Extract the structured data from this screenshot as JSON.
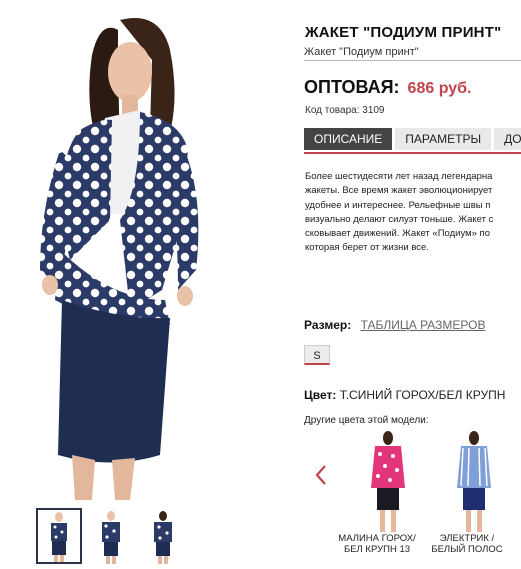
{
  "product": {
    "title": "ЖАКЕТ \"ПОДИУМ ПРИНТ\"",
    "subtitle": "Жакет \"Подиум принт\"",
    "price_label": "ОПТОВАЯ:",
    "price_value": "686 руб.",
    "sku": "Код товара: 3109"
  },
  "tabs": [
    {
      "label": "ОПИСАНИЕ"
    },
    {
      "label": "ПАРАМЕТРЫ"
    },
    {
      "label": "ДО"
    }
  ],
  "description_lines": [
    "Более шестидесяти лет назад легендарна",
    "жакеты. Все время жакет эволюционирует",
    "удобнее и интереснее. Рельефные швы п",
    "визуально делают силуэт тоньше. Жакет с",
    "сковывает движений. Жакет «Подиум» по",
    "которая берет от жизни все."
  ],
  "size": {
    "label": "Размер:",
    "chart_link": "ТАБЛИЦА РАЗМЕРОВ",
    "options": [
      "S"
    ]
  },
  "color": {
    "label": "Цвет:",
    "value": "Т.СИНИЙ ГОРОХ/БЕЛ КРУПН"
  },
  "other_colors_label": "Другие цвета этой модели:",
  "other_colors": [
    {
      "line1": "МАЛИНА ГОРОХ/",
      "line2": "БЕЛ КРУПН 13"
    },
    {
      "line1": "ЭЛЕКТРИК /",
      "line2": "БЕЛЫЙ ПОЛОС"
    }
  ],
  "colors": {
    "accent": "#c0444a",
    "navy": "#2b3a66",
    "active_tab": "#444444"
  },
  "icons": {
    "prev": "chevron-left-icon"
  }
}
